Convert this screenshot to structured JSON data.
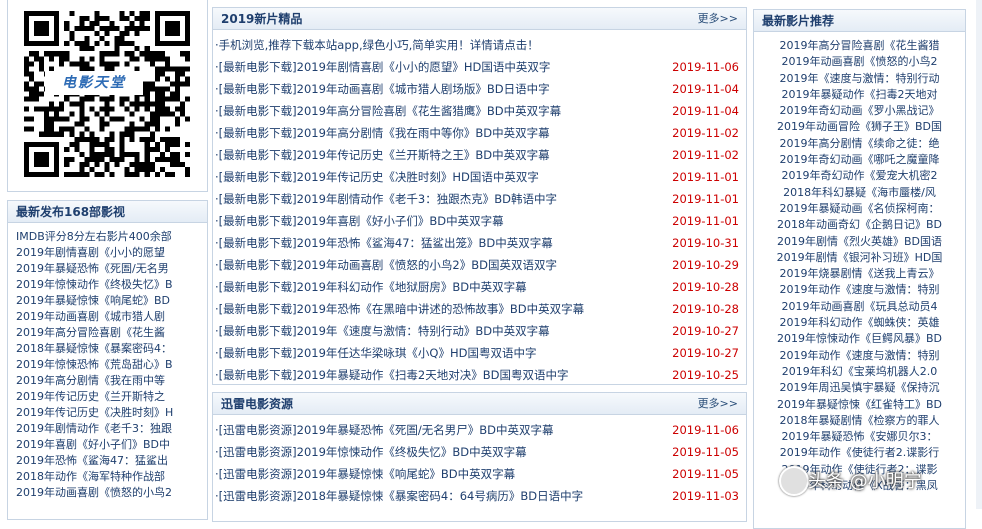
{
  "qr": {
    "label": "电影天堂"
  },
  "latest": {
    "title": "最新发布168部影视",
    "items": [
      "IMDB评分8分左右影片400余部",
      "2019年剧情喜剧《小小的愿望",
      "2019年暴疑恐怖《死圄/无名男",
      "2019年惊悚动作《终极失忆》B",
      "2019年暴疑惊悚《响尾蛇》BD",
      "2019年动画喜剧《城市猎人剧",
      "2019年高分冒险喜剧《花生酱",
      "2018年暴疑惊悚《暴案密码4：",
      "2019年惊悚恐怖《荒岛甜心》B",
      "2019年高分剧情《我在雨中等",
      "2019年传记历史《兰开斯特之",
      "2019年传记历史《决胜时刻》H",
      "2019年剧情动作《老千3：独跟",
      "2019年喜剧《好小子们》BD中",
      "2019年恐怖《鲨海47：猛鲨出",
      "2018年动作《海军特种作战部",
      "2019年动画喜剧《愤怒的小鸟2"
    ]
  },
  "new_releases": {
    "title": "2019新片精品",
    "more": "更多>>",
    "notice": "·手机浏览,推荐下载本站app,绿色小巧,简单实用！详情请点击！",
    "items": [
      {
        "title": "·[最新电影下载]2019年剧情喜剧《小小的愿望》HD国语中英双字",
        "date": "2019-11-06"
      },
      {
        "title": "·[最新电影下载]2019年动画喜剧《城市猎人剧场版》BD日语中字",
        "date": "2019-11-04"
      },
      {
        "title": "·[最新电影下载]2019年高分冒险喜剧《花生酱猎鹰》BD中英双字幕",
        "date": "2019-11-04"
      },
      {
        "title": "·[最新电影下载]2019年高分剧情《我在雨中等你》BD中英双字幕",
        "date": "2019-11-02"
      },
      {
        "title": "·[最新电影下载]2019年传记历史《兰开斯特之王》BD中英双字幕",
        "date": "2019-11-02"
      },
      {
        "title": "·[最新电影下载]2019年传记历史《决胜时刻》HD国语中英双字",
        "date": "2019-11-01"
      },
      {
        "title": "·[最新电影下载]2019年剧情动作《老千3：独跟杰克》BD韩语中字",
        "date": "2019-11-01"
      },
      {
        "title": "·[最新电影下载]2019年喜剧《好小子们》BD中英双字幕",
        "date": "2019-11-01"
      },
      {
        "title": "·[最新电影下载]2019年恐怖《鲨海47：猛鲨出笼》BD中英双字幕",
        "date": "2019-10-31"
      },
      {
        "title": "·[最新电影下载]2019年动画喜剧《愤怒的小鸟2》BD国英双语双字",
        "date": "2019-10-29"
      },
      {
        "title": "·[最新电影下载]2019年科幻动作《地狱厨房》BD中英双字幕",
        "date": "2019-10-28"
      },
      {
        "title": "·[最新电影下载]2019年恐怖《在黑暗中讲述的恐怖故事》BD中英双字幕",
        "date": "2019-10-28"
      },
      {
        "title": "·[最新电影下载]2019年《速度与激情：特别行动》BD中英双字幕",
        "date": "2019-10-27"
      },
      {
        "title": "·[最新电影下载]2019年任达华梁咏琪《小Q》HD国粤双语中字",
        "date": "2019-10-27"
      },
      {
        "title": "·[最新电影下载]2019年暴疑动作《扫毒2天地对决》BD国粤双语中字",
        "date": "2019-10-25"
      }
    ]
  },
  "thunder": {
    "title": "迅雷电影资源",
    "more": "更多>>",
    "items": [
      {
        "title": "·[迅雷电影资源]2019年暴疑恐怖《死圄/无名男尸》BD中英双字幕",
        "date": "2019-11-06"
      },
      {
        "title": "·[迅雷电影资源]2019年惊悚动作《终极失忆》BD中英双字幕",
        "date": "2019-11-05"
      },
      {
        "title": "·[迅雷电影资源]2019年暴疑惊悚《响尾蛇》BD中英双字幕",
        "date": "2019-11-05"
      },
      {
        "title": "·[迅雷电影资源]2018年暴疑惊悚《暴案密码4：64号病历》BD日语中字",
        "date": "2019-11-03"
      }
    ]
  },
  "recommend": {
    "title": "最新影片推荐",
    "items": [
      "2019年高分冒险喜剧《花生酱猎",
      "2019年动画喜剧《愤怒的小鸟2",
      "2019年《速度与激情：特别行动",
      "2019年暴疑动作《扫毒2天地对",
      "2019年奇幻动画《罗小黑战记》",
      "2019年动画冒险《狮子王》BD国",
      "2019年高分剧情《续命之徒：绝",
      "2019年奇幻动画《哪吒之魔童降",
      "2019年奇幻动作《爱宠大机密2",
      "2018年科幻暴疑《海市蜃楼/风",
      "2019年暴疑动画《名侦探柯南：",
      "2018年动画奇幻《企鹅日记》BD",
      "2019年剧情《烈火英雄》BD国语",
      "2019年剧情《银河补习班》HD国",
      "2019年烧暴剧情《送我上青云》",
      "2019年动作《速度与激情：特别",
      "2019年动画喜剧《玩具总动员4",
      "2019年科幻动作《蜘蛛侠：英雄",
      "2019年惊悚动作《巨鳄风暴》BD",
      "2019年动作《速度与激情：特别",
      "2019年科幻《宝莱坞机器人2.0",
      "2019年周迅吴慎宇暴疑《保持沉",
      "2019年暴疑惊悚《红雀特工》BD",
      "2018年暴疑剧情《检察方的罪人",
      "2019年暴疑恐怖《安娜贝尔3：",
      "2019年动作《使徒行者2.谍影行",
      "2019年动作《使徒行者2：谍影",
      "2019年科幻动作《X战警：黑凤"
    ]
  },
  "watermark": {
    "text": "头条 @小明宁"
  }
}
